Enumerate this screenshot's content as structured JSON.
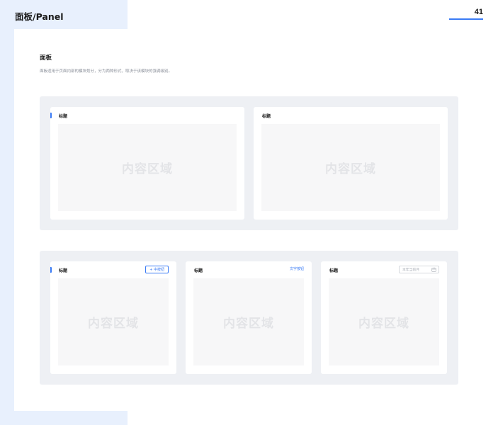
{
  "header": {
    "title": "面板/Panel",
    "page_number": "41"
  },
  "section": {
    "heading": "面板",
    "description": "面板适用于页面内部的模块划分，分为两种形式，取决于该模块的强调级别。"
  },
  "row1": {
    "panels": [
      {
        "title": "标题",
        "content": "内容区域"
      },
      {
        "title": "标题",
        "content": "内容区域"
      }
    ]
  },
  "row2": {
    "panels": [
      {
        "title": "标题",
        "content": "内容区域",
        "action_label": "+ 中按钮"
      },
      {
        "title": "标题",
        "content": "内容区域",
        "action_label": "文字按钮"
      },
      {
        "title": "标题",
        "content": "内容区域",
        "action_placeholder": "本年当前月"
      }
    ]
  },
  "colors": {
    "accent": "#3a7bf5",
    "panel_bg": "#ffffff",
    "container_bg": "#eef0f4",
    "side_band": "#e8f0fd"
  },
  "icons": {
    "calendar": "calendar-icon"
  }
}
